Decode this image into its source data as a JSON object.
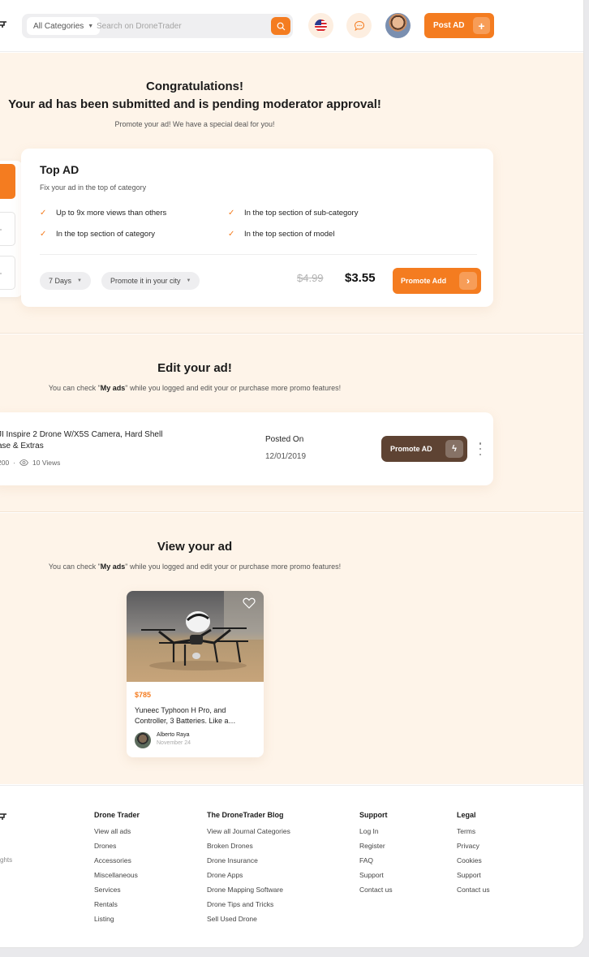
{
  "header": {
    "category_select": "All Categories",
    "search_placeholder": "Search on DroneTrader",
    "post_ad_label": "Post AD",
    "icons": {
      "logo": "drone-logo-icon",
      "search": "search-icon",
      "language": "us-flag-icon",
      "chat": "chat-bubble-icon",
      "avatar": "user-avatar",
      "plus": "plus-icon"
    }
  },
  "congrats": {
    "title": "Congratulations!",
    "message": "Your ad has been submitted and is pending moderator approval!",
    "subtitle": "Promote your ad! We have a special deal for you!"
  },
  "promo": {
    "title": "Top AD",
    "description": "Fix your ad in the top of category",
    "features": [
      "Up to 9x more views than others",
      "In the top section of sub-category",
      "In the top section of category",
      "In the top section of model"
    ],
    "duration": "7 Days",
    "location": "Promote it in your city",
    "old_price": "$4.99",
    "new_price": "$3.55",
    "button": "Promote Add"
  },
  "edit_section": {
    "title": "Edit your ad!",
    "subtitle_pre": "You can check \"",
    "subtitle_bold": "My ads",
    "subtitle_post": "\" while you logged and edit your or purchase more promo features!",
    "ad": {
      "title_line1": "JI Inspire 2 Drone W/X5S Camera, Hard Shell",
      "title_line2": "ase & Extras",
      "price": "200",
      "views": "10 Views",
      "posted_label": "Posted On",
      "posted_date": "12/01/2019",
      "button": "Promote AD"
    }
  },
  "view_section": {
    "title": "View your ad",
    "subtitle_pre": "You can check \"",
    "subtitle_bold": "My ads",
    "subtitle_post": "\" while you logged and edit your or purchase more promo features!",
    "listing": {
      "price": "$785",
      "title": "Yuneec Typhoon H Pro, and Controller, 3 Batteries. Like a…",
      "seller": "Alberto Raya",
      "date": "November 24"
    }
  },
  "footer": {
    "rights": "ghts",
    "columns": [
      {
        "heading": "Drone Trader",
        "links": [
          "View all ads",
          "Drones",
          "Accessories",
          "Miscellaneous",
          "Services",
          "Rentals",
          "Listing"
        ]
      },
      {
        "heading": "The DroneTrader Blog",
        "links": [
          "View all Journal Categories",
          "Broken Drones",
          "Drone Insurance",
          "Drone Apps",
          "Drone Mapping Software",
          "Drone Tips and Tricks",
          "Sell Used Drone"
        ]
      },
      {
        "heading": "Support",
        "links": [
          "Log In",
          "Register",
          "FAQ",
          "Support",
          "Contact us"
        ]
      },
      {
        "heading": "Legal",
        "links": [
          "Terms",
          "Privacy",
          "Cookies",
          "Support",
          "Contact us"
        ]
      }
    ]
  },
  "colors": {
    "accent": "#f47c20",
    "section_bg": "#fef4e9",
    "brown": "#5e4333"
  }
}
